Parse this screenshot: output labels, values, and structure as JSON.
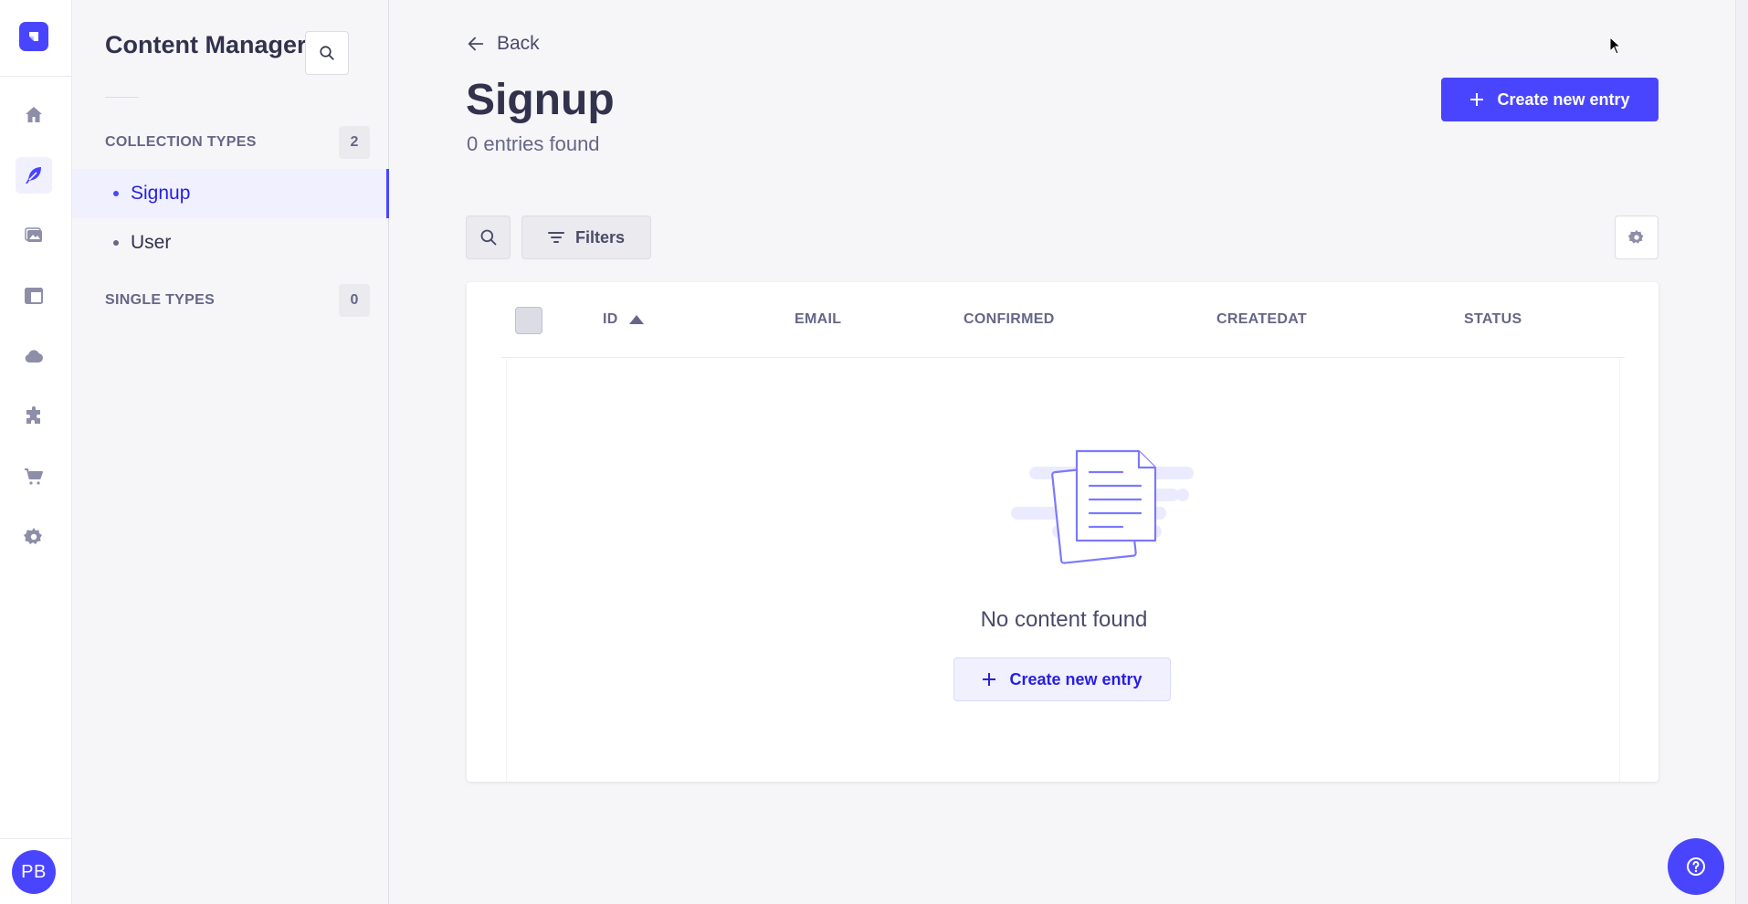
{
  "rail": {
    "items": [
      {
        "icon": "home-icon"
      },
      {
        "icon": "feather-icon"
      },
      {
        "icon": "media-library-icon"
      },
      {
        "icon": "layout-icon"
      },
      {
        "icon": "cloud-icon"
      },
      {
        "icon": "puzzle-icon"
      },
      {
        "icon": "cart-icon"
      },
      {
        "icon": "gear-icon"
      }
    ],
    "active_index": 1,
    "avatar_initials": "PB"
  },
  "subnav": {
    "title": "Content Manager",
    "collection_types": {
      "label": "COLLECTION TYPES",
      "count": "2"
    },
    "items": [
      {
        "label": "Signup",
        "active": true
      },
      {
        "label": "User",
        "active": false
      }
    ],
    "single_types": {
      "label": "SINGLE TYPES",
      "count": "0"
    }
  },
  "header": {
    "back_label": "Back",
    "title": "Signup",
    "subtitle": "0 entries found",
    "create_label": "Create new entry"
  },
  "toolbar": {
    "filters_label": "Filters"
  },
  "table": {
    "columns": [
      "ID",
      "EMAIL",
      "CONFIRMED",
      "CREATEDAT",
      "STATUS"
    ],
    "sorted_column": "ID",
    "sort_direction": "ascending",
    "empty_text": "No content found",
    "empty_create_label": "Create new entry"
  },
  "colors": {
    "primary": "#4945ff",
    "background": "#f6f6f9",
    "text": "#32324d",
    "muted": "#666687"
  }
}
